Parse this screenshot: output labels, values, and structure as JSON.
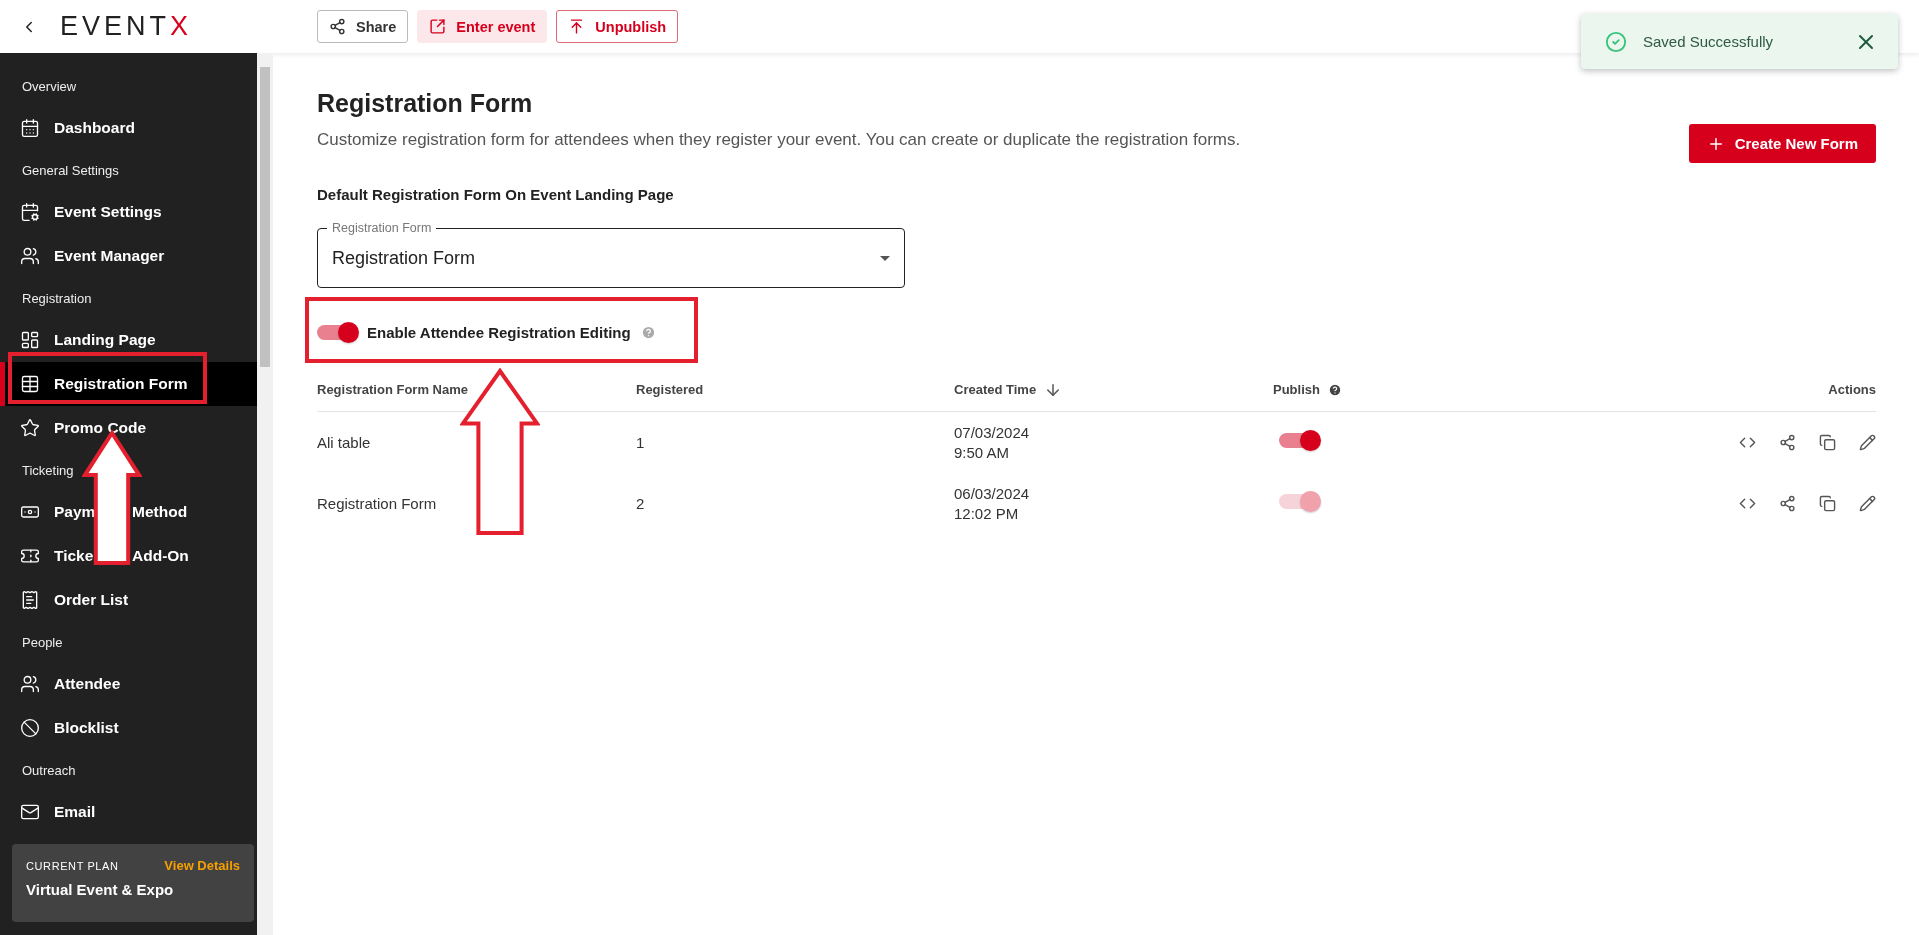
{
  "logo": {
    "text": "EVENT",
    "accent": "X"
  },
  "top_actions": [
    {
      "kind": "outline",
      "label": "Share"
    },
    {
      "kind": "tinted",
      "label": "Enter event"
    },
    {
      "kind": "danger",
      "label": "Unpublish"
    }
  ],
  "toast": {
    "message": "Saved Successfully"
  },
  "sidebar": {
    "sections": [
      {
        "title": "Overview",
        "items": [
          {
            "label_parts": [
              "Dashboard"
            ],
            "selected": false
          }
        ]
      },
      {
        "title": "General Settings",
        "items": [
          {
            "label_parts": [
              "Event Settings"
            ],
            "selected": false
          },
          {
            "label_parts": [
              "Event Manager"
            ],
            "selected": false
          }
        ]
      },
      {
        "title": "Registration",
        "items": [
          {
            "label_parts": [
              "Landing Page"
            ],
            "selected": false
          },
          {
            "label_parts": [
              "Registration Form"
            ],
            "selected": true
          },
          {
            "label_parts": [
              "Promo Code"
            ],
            "selected": false
          }
        ]
      },
      {
        "title": "Ticketing",
        "items": [
          {
            "label_parts": [
              "Paym",
              "Method"
            ],
            "selected": false
          },
          {
            "label_parts": [
              "Ticke",
              "Add-On"
            ],
            "selected": false
          },
          {
            "label_parts": [
              "Order List"
            ],
            "selected": false
          }
        ]
      },
      {
        "title": "People",
        "items": [
          {
            "label_parts": [
              "Attendee"
            ],
            "selected": false
          },
          {
            "label_parts": [
              "Blocklist"
            ],
            "selected": false
          }
        ]
      },
      {
        "title": "Outreach",
        "items": [
          {
            "label_parts": [
              "Email"
            ],
            "selected": false
          }
        ]
      }
    ],
    "plan": {
      "caption": "CURRENT PLAN",
      "link": "View Details",
      "name": "Virtual Event & Expo"
    }
  },
  "page": {
    "title": "Registration Form",
    "description": "Customize registration form for attendees when they register your event. You can create or duplicate the registration forms.",
    "create_button": "Create New Form",
    "default_form": {
      "heading": "Default Registration Form On Event Landing Page",
      "select": {
        "label": "Registration Form",
        "value": "Registration Form"
      }
    },
    "toggle": {
      "label": "Enable Attendee Registration Editing",
      "on": true
    },
    "table": {
      "columns": [
        {
          "label": "Registration Form Name",
          "kind": "plain"
        },
        {
          "label": "Registered",
          "kind": "plain"
        },
        {
          "label": "Created Time",
          "kind": "sort"
        },
        {
          "label": "Publish",
          "kind": "help"
        },
        {
          "label": "Actions",
          "kind": "plain"
        }
      ],
      "rows": [
        {
          "name": "Ali table",
          "registered": "1",
          "date": "07/03/2024",
          "time": "9:50 AM",
          "publish": {
            "on": true,
            "disabled": false
          }
        },
        {
          "name": "Registration Form",
          "registered": "2",
          "date": "06/03/2024",
          "time": "12:02 PM",
          "publish": {
            "on": true,
            "disabled": true
          }
        }
      ]
    }
  }
}
